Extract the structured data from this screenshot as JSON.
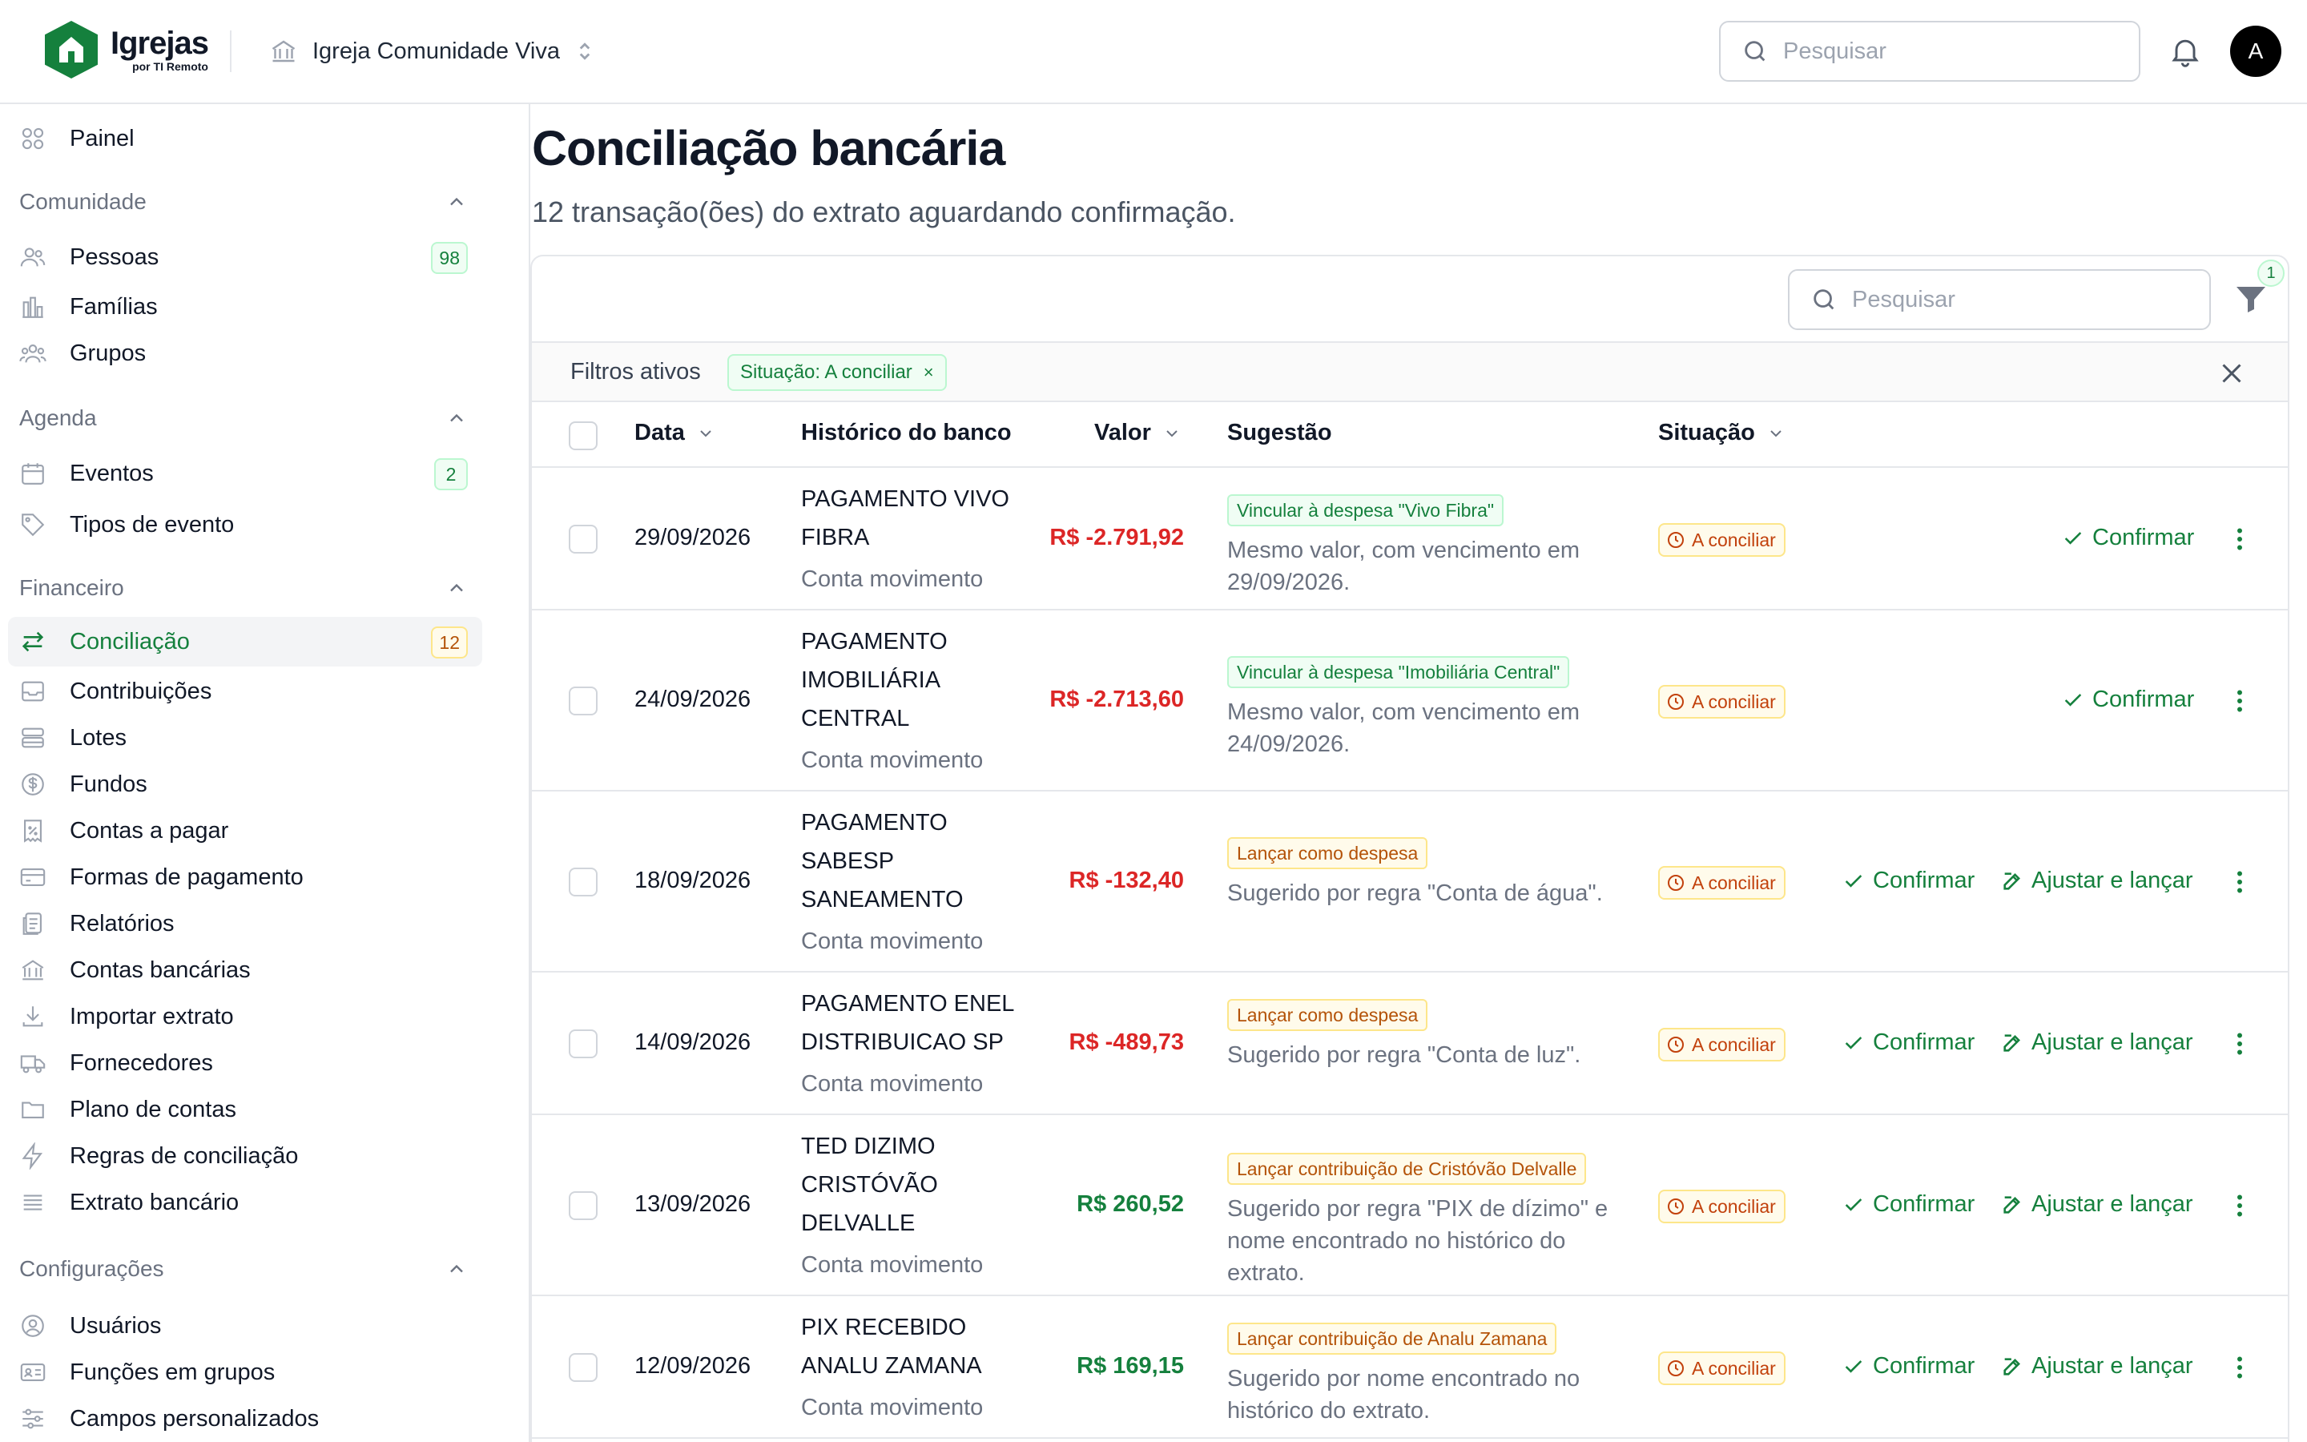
{
  "header": {
    "brand": "Igrejas",
    "brand_by": "por TI Remoto",
    "org_name": "Igreja Comunidade Viva",
    "search_placeholder": "Pesquisar",
    "avatar_initial": "A"
  },
  "sidebar": {
    "dashboard": "Painel",
    "sections": {
      "comunidade": "Comunidade",
      "agenda": "Agenda",
      "financeiro": "Financeiro",
      "configuracoes": "Configurações"
    },
    "items": {
      "pessoas": {
        "label": "Pessoas",
        "badge": "98"
      },
      "familias": {
        "label": "Famílias"
      },
      "grupos": {
        "label": "Grupos"
      },
      "eventos": {
        "label": "Eventos",
        "badge": "2"
      },
      "tipos_evento": {
        "label": "Tipos de evento"
      },
      "conciliacao": {
        "label": "Conciliação",
        "badge": "12"
      },
      "contribuicoes": {
        "label": "Contribuições"
      },
      "lotes": {
        "label": "Lotes"
      },
      "fundos": {
        "label": "Fundos"
      },
      "contas_pagar": {
        "label": "Contas a pagar"
      },
      "formas_pagamento": {
        "label": "Formas de pagamento"
      },
      "relatorios": {
        "label": "Relatórios"
      },
      "contas_bancarias": {
        "label": "Contas bancárias"
      },
      "importar_extrato": {
        "label": "Importar extrato"
      },
      "fornecedores": {
        "label": "Fornecedores"
      },
      "plano_contas": {
        "label": "Plano de contas"
      },
      "regras_conciliacao": {
        "label": "Regras de conciliação"
      },
      "extrato_bancario": {
        "label": "Extrato bancário"
      },
      "usuarios": {
        "label": "Usuários"
      },
      "funcoes_grupos": {
        "label": "Funções em grupos"
      },
      "campos_personalizados": {
        "label": "Campos personalizados"
      }
    }
  },
  "page": {
    "title": "Conciliação bancária",
    "subtitle": "12 transação(ões) do extrato aguardando confirmação."
  },
  "toolbar": {
    "search_placeholder": "Pesquisar",
    "filter_count": "1"
  },
  "filters": {
    "label": "Filtros ativos",
    "chip": "Situação: A conciliar",
    "chip_remove": "×"
  },
  "table": {
    "columns": {
      "date": "Data",
      "history": "Histórico do banco",
      "value": "Valor",
      "suggestion": "Sugestão",
      "status": "Situação"
    },
    "actions": {
      "confirm": "Confirmar",
      "adjust": "Ajustar e lançar"
    },
    "rows": [
      {
        "date": "29/09/2026",
        "history": [
          "PAGAMENTO VIVO",
          "FIBRA"
        ],
        "account": "Conta movimento",
        "value": "R$ -2.791,92",
        "sign": "neg",
        "tag": "Vincular à despesa \"Vivo Fibra\"",
        "tag_color": "green",
        "note": "Mesmo valor, com vencimento em 29/09/2026.",
        "status": "A conciliar",
        "adjust": false
      },
      {
        "date": "24/09/2026",
        "history": [
          "PAGAMENTO",
          "IMOBILIÁRIA",
          "CENTRAL"
        ],
        "account": "Conta movimento",
        "value": "R$ -2.713,60",
        "sign": "neg",
        "tag": "Vincular à despesa \"Imobiliária Central\"",
        "tag_color": "green",
        "note": "Mesmo valor, com vencimento em 24/09/2026.",
        "status": "A conciliar",
        "adjust": false
      },
      {
        "date": "18/09/2026",
        "history": [
          "PAGAMENTO",
          "SABESP",
          "SANEAMENTO"
        ],
        "account": "Conta movimento",
        "value": "R$ -132,40",
        "sign": "neg",
        "tag": "Lançar como despesa",
        "tag_color": "amber",
        "note": "Sugerido por regra \"Conta de água\".",
        "status": "A conciliar",
        "adjust": true
      },
      {
        "date": "14/09/2026",
        "history": [
          "PAGAMENTO ENEL",
          "DISTRIBUICAO SP"
        ],
        "account": "Conta movimento",
        "value": "R$ -489,73",
        "sign": "neg",
        "tag": "Lançar como despesa",
        "tag_color": "amber",
        "note": "Sugerido por regra \"Conta de luz\".",
        "status": "A conciliar",
        "adjust": true
      },
      {
        "date": "13/09/2026",
        "history": [
          "TED DIZIMO",
          "CRISTÓVÃO",
          "DELVALLE"
        ],
        "account": "Conta movimento",
        "value": "R$ 260,52",
        "sign": "pos",
        "tag": "Lançar contribuição de Cristóvão Delvalle",
        "tag_color": "amber",
        "note": "Sugerido por regra \"PIX de dízimo\" e nome encontrado no histórico do extrato.",
        "status": "A conciliar",
        "adjust": true
      },
      {
        "date": "12/09/2026",
        "history": [
          "PIX RECEBIDO",
          "ANALU ZAMANA"
        ],
        "account": "Conta movimento",
        "value": "R$ 169,15",
        "sign": "pos",
        "tag": "Lançar contribuição de Analu Zamana",
        "tag_color": "amber",
        "note": "Sugerido por nome encontrado no histórico do extrato.",
        "status": "A conciliar",
        "adjust": true
      }
    ]
  },
  "colors": {
    "accent": "#15803d",
    "negative": "#dc2626",
    "warning": "#b45309"
  }
}
